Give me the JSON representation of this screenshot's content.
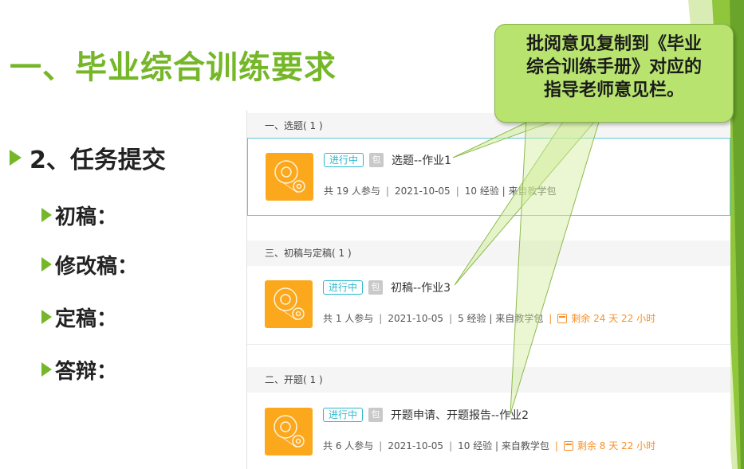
{
  "slide": {
    "title": "一、毕业综合训练要求",
    "bullet_main": "2、任务提交",
    "sub_bullets": [
      "初稿：",
      "修改稿：",
      "定稿：",
      "答辩："
    ]
  },
  "callout": {
    "lines": [
      "批阅意见复制到《毕业",
      "综合训练手册》对应的",
      "指导老师意见栏。"
    ]
  },
  "sections": [
    {
      "header": "一、选题( 1 )",
      "assignment": {
        "status": "进行中",
        "package_icon_label": "包",
        "title": "选题--作业1",
        "participants": "共 19 人参与",
        "date": "2021-10-05",
        "exp": "10 经验",
        "source": "来自教学包",
        "remaining": ""
      }
    },
    {
      "header": "三、初稿与定稿( 1 )",
      "assignment": {
        "status": "进行中",
        "package_icon_label": "包",
        "title": "初稿--作业3",
        "participants": "共 1 人参与",
        "date": "2021-10-05",
        "exp": "5 经验",
        "source": "来自教学包",
        "remaining": "剩余 24 天 22 小时"
      }
    },
    {
      "header": "二、开题( 1 )",
      "assignment": {
        "status": "进行中",
        "package_icon_label": "包",
        "title": "开题申请、开题报告--作业2",
        "participants": "共 6 人参与",
        "date": "2021-10-05",
        "exp": "10 经验",
        "source": "来自教学包",
        "remaining": "剩余 8 天 22 小时"
      }
    }
  ],
  "colors": {
    "accent_green": "#76b72a",
    "callout_fill": "#b8e36f",
    "status_teal": "#2eb8cc",
    "thumb_orange": "#fca81d",
    "remaining_orange": "#f7902a"
  }
}
